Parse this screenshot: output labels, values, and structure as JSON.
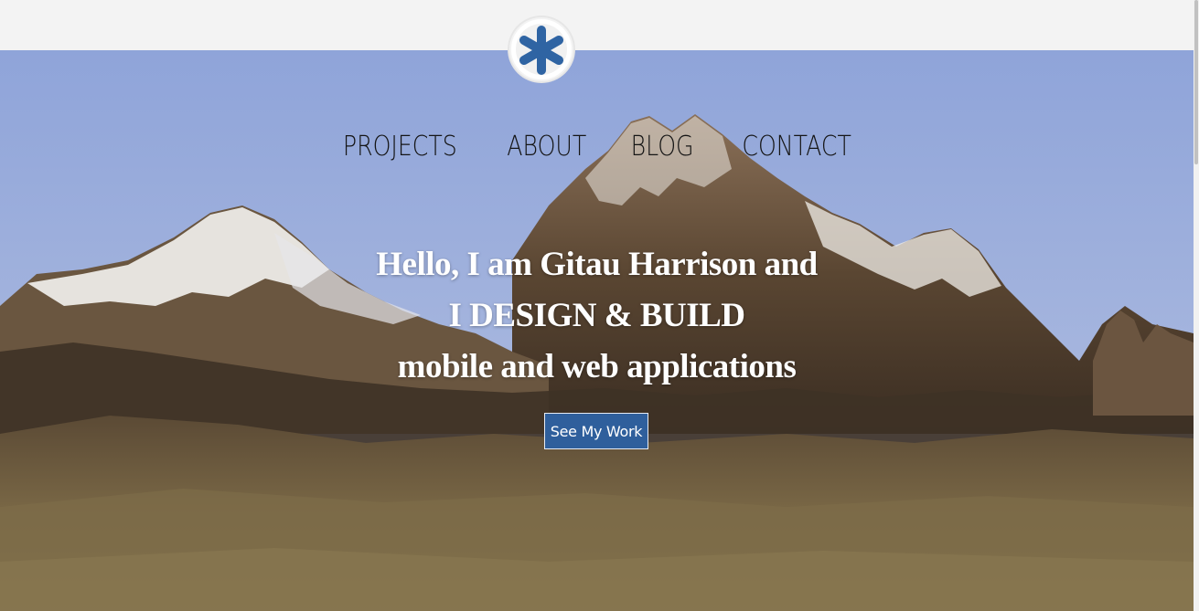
{
  "nav": {
    "items": [
      {
        "label": "PROJECTS"
      },
      {
        "label": "ABOUT"
      },
      {
        "label": "BLOG"
      },
      {
        "label": "CONTACT"
      }
    ]
  },
  "hero": {
    "line1": "Hello, I am Gitau Harrison and",
    "line2": "I DESIGN & BUILD",
    "line3": "mobile and web applications",
    "cta_label": "See My Work"
  },
  "logo": {
    "icon": "asterisk-icon"
  },
  "colors": {
    "accent": "#2f5f9c",
    "logo_blue": "#2f64a3",
    "topbar": "#f3f3f3",
    "sky": "#9aaedc"
  }
}
